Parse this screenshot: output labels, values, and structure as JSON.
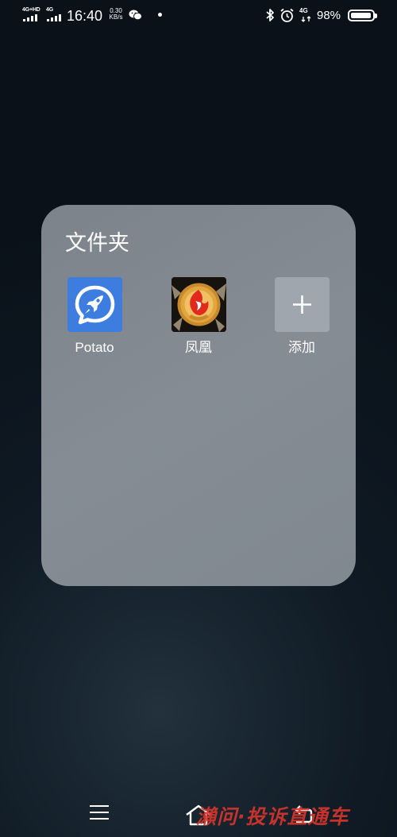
{
  "status_bar": {
    "sim1_network": "4G+HD",
    "sim2_network": "4G",
    "time": "16:40",
    "net_speed_value": "0.30",
    "net_speed_unit": "KB/s",
    "data_network": "4G",
    "battery_percent": "98%",
    "battery_level": 0.98,
    "icons": [
      "wechat-icon",
      "bluetooth-icon",
      "alarm-icon",
      "battery-icon"
    ]
  },
  "folder": {
    "title": "文件夹",
    "apps": [
      {
        "label": "Potato",
        "icon": "rocket-chat-icon",
        "color": "#3d7de0"
      },
      {
        "label": "凤凰",
        "icon": "phoenix-app-icon",
        "color": "#e02a1e"
      },
      {
        "label": "添加",
        "icon": "plus-icon",
        "color": "#a0a6ad"
      }
    ]
  },
  "nav_bar": {
    "icons": [
      "menu-icon",
      "home-icon",
      "back-icon"
    ]
  },
  "watermark": "瀨问·投诉直通车"
}
